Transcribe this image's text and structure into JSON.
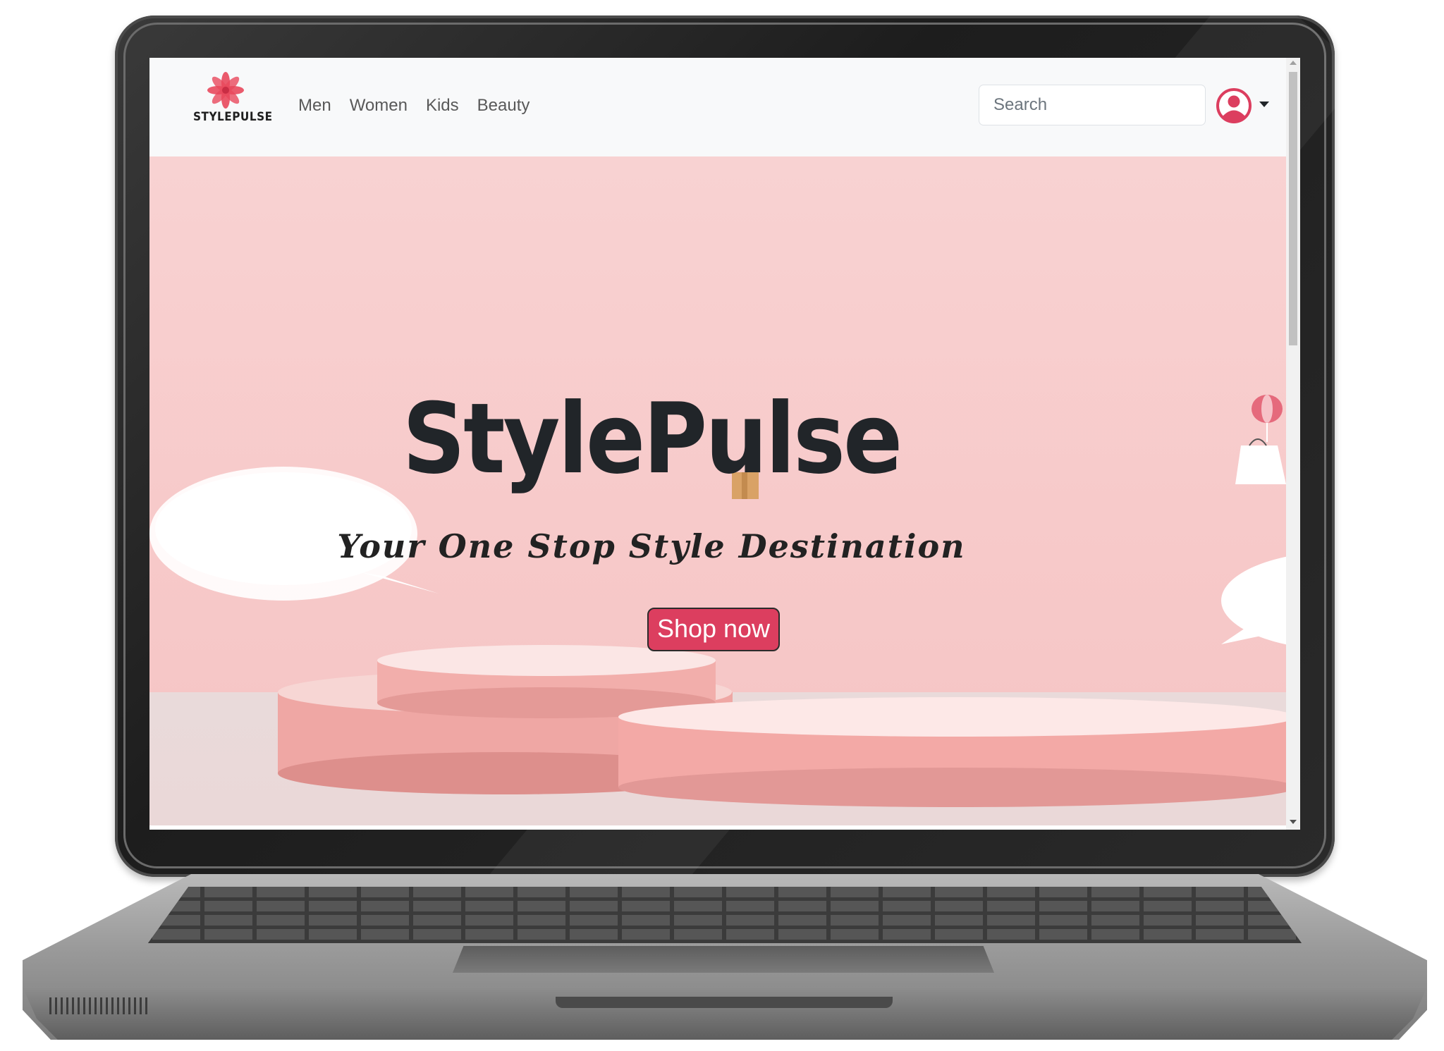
{
  "navbar": {
    "brand": "STYLEPULSE",
    "links": [
      "Men",
      "Women",
      "Kids",
      "Beauty"
    ],
    "search_placeholder": "Search",
    "user_icon": "user-circle-icon"
  },
  "hero": {
    "title": "StylePulse",
    "subtitle": "Your One Stop Style Destination",
    "cta": "Shop now"
  },
  "colors": {
    "accent": "#dc3e5f",
    "logo": "#e8485c",
    "hero_bg": "#f8d2d2",
    "podium": "#f3a9a6",
    "navbar_bg": "#f8f9fa"
  }
}
